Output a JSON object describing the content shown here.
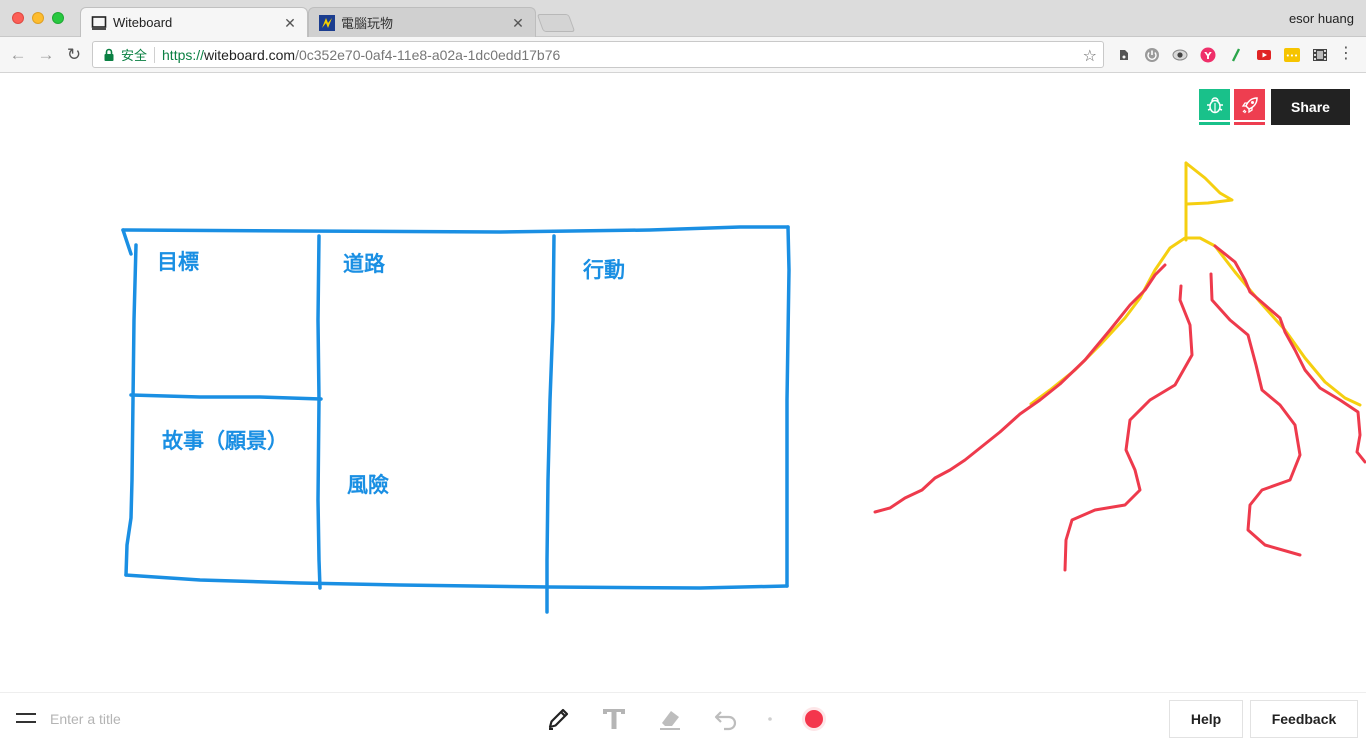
{
  "browser": {
    "tabs": [
      {
        "title": "Witeboard",
        "active": true
      },
      {
        "title": "電腦玩物",
        "active": false
      }
    ],
    "profile_name": "esor huang",
    "security_label": "安全",
    "url": {
      "scheme": "https://",
      "host": "witeboard.com",
      "path": "/0c352e70-0af4-11e8-a02a-1dc0edd17b76"
    },
    "extensions": [
      "evernote-icon",
      "power-icon",
      "eye-icon",
      "pink-extension-icon",
      "green-slash-icon",
      "red-play-icon",
      "yellow-extension-icon",
      "film-icon"
    ]
  },
  "board": {
    "labels": {
      "goal": "目標",
      "road": "道路",
      "action": "行動",
      "story": "故事（願景）",
      "risk": "風險"
    },
    "stroke_colors": {
      "blue": "#1a8fe3",
      "red": "#ee3a4c",
      "yellow": "#f5cf10"
    }
  },
  "top_actions": {
    "share_label": "Share",
    "tiles": [
      "bug-icon",
      "rocket-icon"
    ],
    "tile_colors": [
      "#19c18a",
      "#ee3e50"
    ]
  },
  "bottom": {
    "title_placeholder": "Enter a title",
    "tools": [
      "pencil-icon",
      "text-icon",
      "eraser-icon",
      "undo-icon",
      "stroke-size-icon"
    ],
    "active_color": "#f4364c",
    "help_label": "Help",
    "feedback_label": "Feedback"
  }
}
